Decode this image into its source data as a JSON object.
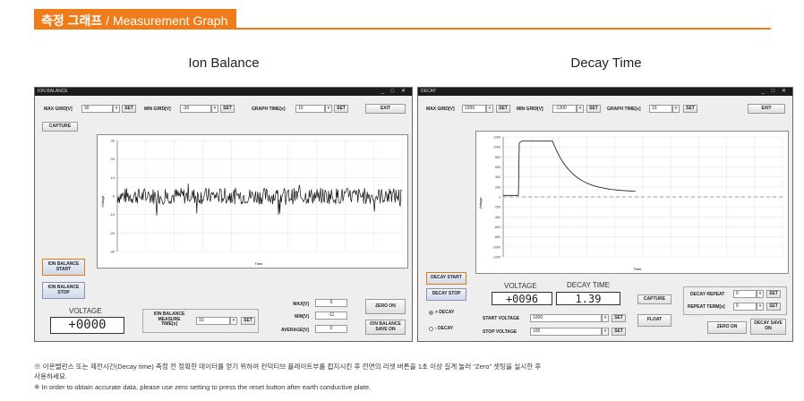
{
  "header": {
    "title_ko": "측정 그래프",
    "title_sep": " / ",
    "title_en": "Measurement Graph"
  },
  "ion": {
    "panel_title": "Ion Balance",
    "window_title": "ION BALANCE",
    "window_controls": "_ □ ✕",
    "max_grid_label": "MAX GRID[V]",
    "max_grid_value": "30",
    "min_grid_label": "MIN GRID[V]",
    "min_grid_value": "-30",
    "graph_time_label": "GRAPH TIME[s]",
    "graph_time_value": "10",
    "set_label": "SET",
    "exit_label": "EXIT",
    "capture_label": "CAPTURE",
    "start_label": "ION BALANCE START",
    "stop_label": "ION BALANCE STOP",
    "voltage_label": "VOLTAGE",
    "voltage_value": "+0000",
    "measure_time_label": "ION BALANCE MEASURE TIME[s]",
    "measure_time_value": "10",
    "max_label": "MAX[V]",
    "max_value": "0",
    "min_label": "MIN[V]",
    "min_value": "-11",
    "avg_label": "AVERAGE[V]",
    "avg_value": "0",
    "zero_on_label": "ZERO ON",
    "save_label": "ION BALANCE SAVE ON",
    "plot_xlabel": "Time",
    "plot_ylabel": "Voltage",
    "plot_yticks": [
      "30",
      "20",
      "10",
      "0",
      "-10",
      "-20",
      "-30"
    ]
  },
  "decay": {
    "panel_title": "Decay Time",
    "window_title": "DECAY",
    "window_controls": "_ □ ✕",
    "max_grid_label": "MAX GRID[V]",
    "max_grid_value": "1200",
    "min_grid_label": "MIN GRID[V]",
    "min_grid_value": "-1200",
    "graph_time_label": "GRAPH TIME[s]",
    "graph_time_value": "10",
    "set_label": "SET",
    "exit_label": "EXIT",
    "decay_start_label": "DECAY START",
    "decay_stop_label": "DECAY STOP",
    "plus_decay_label": "+ DECAY",
    "minus_decay_label": "- DECAY",
    "voltage_label": "VOLTAGE",
    "voltage_value": "+0096",
    "decay_time_label": "DECAY TIME",
    "decay_time_value": "1.39",
    "capture_label": "CAPTURE",
    "float_label": "FLOAT",
    "start_voltage_label": "START VOLTAGE",
    "start_voltage_value": "1000",
    "stop_voltage_label": "STOP VOLTAGE",
    "stop_voltage_value": "100",
    "repeat_label": "DECAY REPEAT",
    "repeat_value": "0",
    "repeat_term_label": "REPEAT TERM[s]",
    "repeat_term_value": "0",
    "zero_on_label": "ZERO ON",
    "save_label": "DECAY SAVE ON",
    "plot_xlabel": "Time",
    "plot_ylabel": "Voltage",
    "plot_yticks": [
      "1200",
      "1000",
      "800",
      "600",
      "400",
      "200",
      "0",
      "-200",
      "-400",
      "-600",
      "-800",
      "-1000",
      "-1200"
    ]
  },
  "notes": {
    "ko": "※ 이온밸런스 또는 제전시간(Decay time) 측정 전 정확한 데이터를 얻기 위하여 컨덕티브 플레이트부를 접지시킨 후 전면의 리셋 버튼을 1초 이상 길게 눌러 “Zero” 셋팅을 실시한 후",
    "ko2": "사용하세요.",
    "en": "※ In order to obtain accurate data, please use zero setting to press the reset button after earth conductive plate."
  },
  "colors": {
    "accent": "#ee7c1b",
    "window_bg": "#eeeeee",
    "titlebar": "#1c1c1c"
  }
}
